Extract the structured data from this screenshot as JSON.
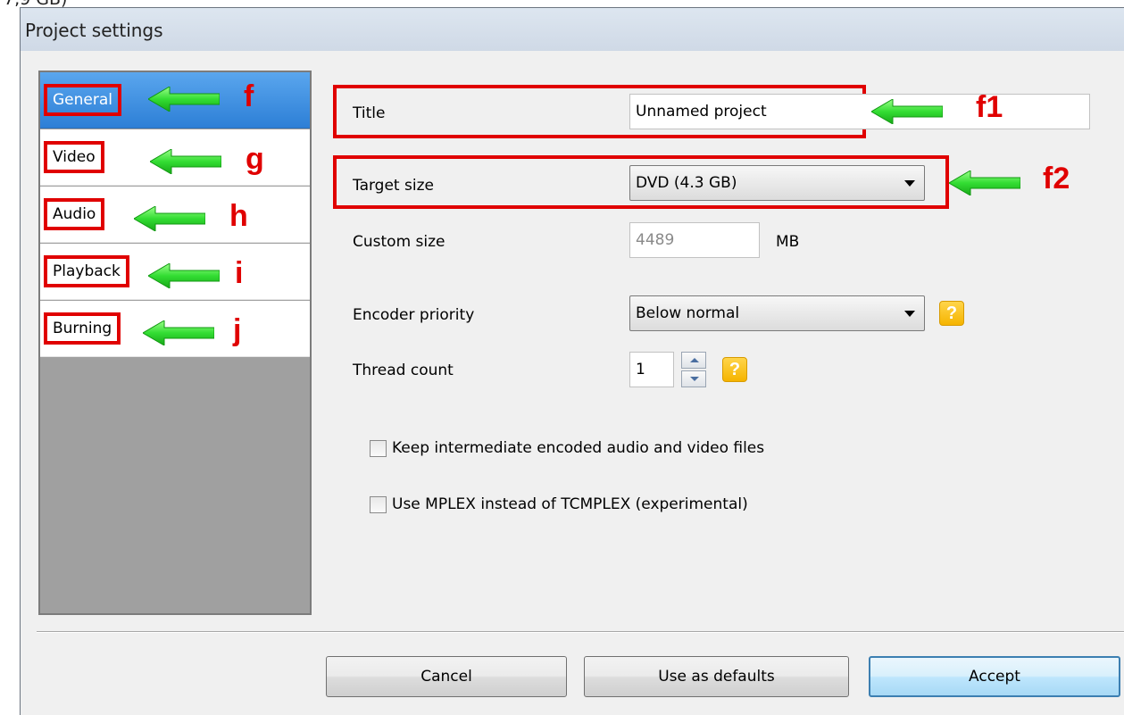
{
  "top_fragment": "7,9 GB)",
  "window": {
    "title": "Project settings"
  },
  "sidebar": {
    "items": [
      {
        "label": "General",
        "selected": true,
        "annotation": "f"
      },
      {
        "label": "Video",
        "selected": false,
        "annotation": "g"
      },
      {
        "label": "Audio",
        "selected": false,
        "annotation": "h"
      },
      {
        "label": "Playback",
        "selected": false,
        "annotation": "i"
      },
      {
        "label": "Burning",
        "selected": false,
        "annotation": "j"
      }
    ]
  },
  "general": {
    "title_label": "Title",
    "title_value": "Unnamed project",
    "title_annotation": "f1",
    "target_size_label": "Target size",
    "target_size_value": "DVD (4.3 GB)",
    "target_size_annotation": "f2",
    "custom_size_label": "Custom size",
    "custom_size_value": "4489",
    "custom_size_unit": "MB",
    "encoder_priority_label": "Encoder priority",
    "encoder_priority_value": "Below normal",
    "thread_count_label": "Thread count",
    "thread_count_value": "1",
    "help_glyph": "?",
    "keep_files_label": "Keep intermediate encoded audio and video files",
    "keep_files_checked": false,
    "use_mplex_label": "Use MPLEX instead of TCMPLEX (experimental)",
    "use_mplex_checked": false
  },
  "buttons": {
    "cancel": "Cancel",
    "use_defaults": "Use as defaults",
    "accept": "Accept"
  },
  "colors": {
    "annotation_red": "#e00000",
    "arrow_green": "#33dd33",
    "selection_blue": "#2d7fd6",
    "help_yellow": "#f5b400"
  }
}
